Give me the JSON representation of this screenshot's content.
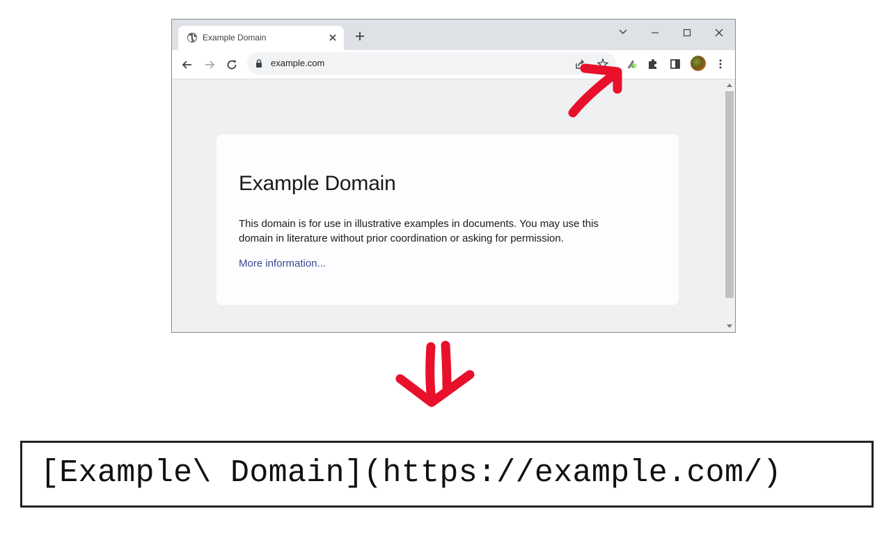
{
  "browser": {
    "tab_title": "Example Domain",
    "url": "example.com",
    "icons": {
      "favicon": "globe-icon",
      "tab_close": "close-icon",
      "new_tab": "plus-icon",
      "window_controls": [
        "chevron-down-icon",
        "minimize-icon",
        "maximize-icon",
        "close-icon"
      ],
      "nav": [
        "back-arrow-icon",
        "forward-arrow-icon",
        "reload-icon"
      ],
      "omnibox": [
        "lock-icon",
        "share-icon",
        "star-icon"
      ],
      "toolbar": [
        "extension-active-icon",
        "puzzle-icon",
        "side-panel-icon",
        "avatar",
        "kebab-menu-icon"
      ]
    }
  },
  "page": {
    "heading": "Example Domain",
    "body": "This domain is for use in illustrative examples in documents. You may use this domain in literature without prior coordination or asking for permission.",
    "link_text": "More information..."
  },
  "annotation": {
    "arrow_color": "#e8102a"
  },
  "output": {
    "markdown_link": "[Example\\ Domain](https://example.com/)"
  }
}
